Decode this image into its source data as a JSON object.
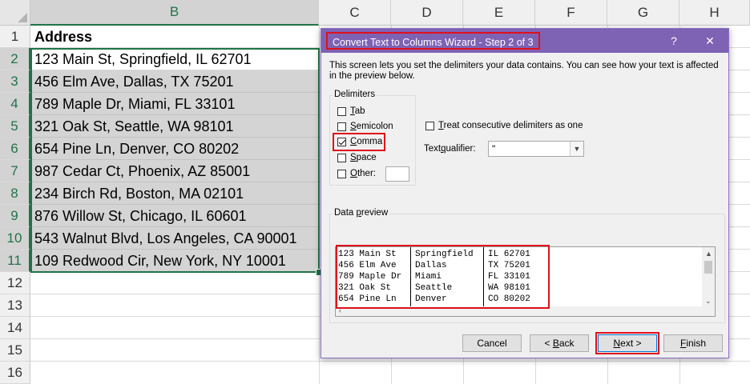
{
  "spreadsheet": {
    "columns": [
      "B",
      "C",
      "D",
      "E",
      "F",
      "G",
      "H"
    ],
    "rows": [
      "1",
      "2",
      "3",
      "4",
      "5",
      "6",
      "7",
      "8",
      "9",
      "10",
      "11",
      "12",
      "13",
      "14",
      "15",
      "16"
    ],
    "cells": [
      "Address",
      "123 Main St, Springfield, IL 62701",
      "456 Elm Ave, Dallas, TX 75201",
      "789 Maple Dr, Miami, FL 33101",
      "321 Oak St, Seattle, WA 98101",
      "654 Pine Ln, Denver, CO 80202",
      "987 Cedar Ct, Phoenix, AZ 85001",
      "234 Birch Rd, Boston, MA 02101",
      "876 Willow St, Chicago, IL 60601",
      "543 Walnut Blvd, Los Angeles, CA 90001",
      "109 Redwood Cir, New York, NY 10001"
    ]
  },
  "dialog": {
    "title": "Convert Text to Columns Wizard - Step 2 of 3",
    "help": "?",
    "close": "✕",
    "description": "This screen lets you set the delimiters your data contains.  You can see how your text is affected in the preview below.",
    "delimiters_label": "Delimiters",
    "tab": {
      "pre": "",
      "u": "T",
      "post": "ab",
      "checked": false
    },
    "semicolon": {
      "pre": "",
      "u": "S",
      "post": "emicolon",
      "checked": false
    },
    "comma": {
      "pre": "",
      "u": "C",
      "post": "omma",
      "checked": true
    },
    "space": {
      "pre": "",
      "u": "S",
      "post": "pace",
      "checked": false
    },
    "other": {
      "pre": "",
      "u": "O",
      "post": "ther:",
      "checked": false
    },
    "consecutive": {
      "pre": "",
      "u": "T",
      "post": "reat consecutive delimiters as one",
      "checked": false
    },
    "qualifier_label": {
      "pre": "Text ",
      "u": "q",
      "post": "ualifier:"
    },
    "qualifier_value": "\"",
    "preview_label": {
      "pre": "Data ",
      "u": "p",
      "post": "review"
    },
    "preview_col1": "123 Main St\n456 Elm Ave\n789 Maple Dr\n321 Oak St\n654 Pine Ln",
    "preview_col2": "Springfield\nDallas\nMiami\nSeattle\nDenver",
    "preview_col3": "IL 62701\nTX 75201\nFL 33101\nWA 98101\nCO 80202",
    "buttons": {
      "cancel": "Cancel",
      "back": {
        "pre": "< ",
        "u": "B",
        "post": "ack"
      },
      "next": {
        "pre": "",
        "u": "N",
        "post": "ext >"
      },
      "finish": {
        "pre": "",
        "u": "F",
        "post": "inish"
      }
    }
  }
}
